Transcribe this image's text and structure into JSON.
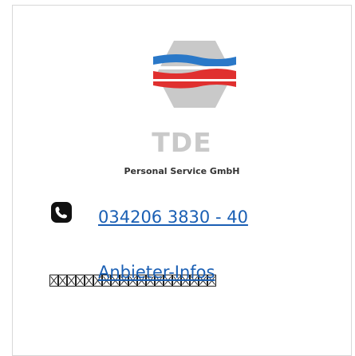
{
  "brand": {
    "name": "TDE",
    "tagline": "Personal Service GmbH",
    "icon": "tde-hexagon-logo"
  },
  "contact": {
    "phone_icon": "phone-icon",
    "phone": "034206 3830 - 40",
    "info_link": "Anbieter-Infos",
    "link_color": "#1a5fb4"
  },
  "colors": {
    "logo_grey": "#c9c9c9",
    "logo_blue": "#2a78c8",
    "logo_red": "#e0302f",
    "text_dark": "#333333"
  }
}
